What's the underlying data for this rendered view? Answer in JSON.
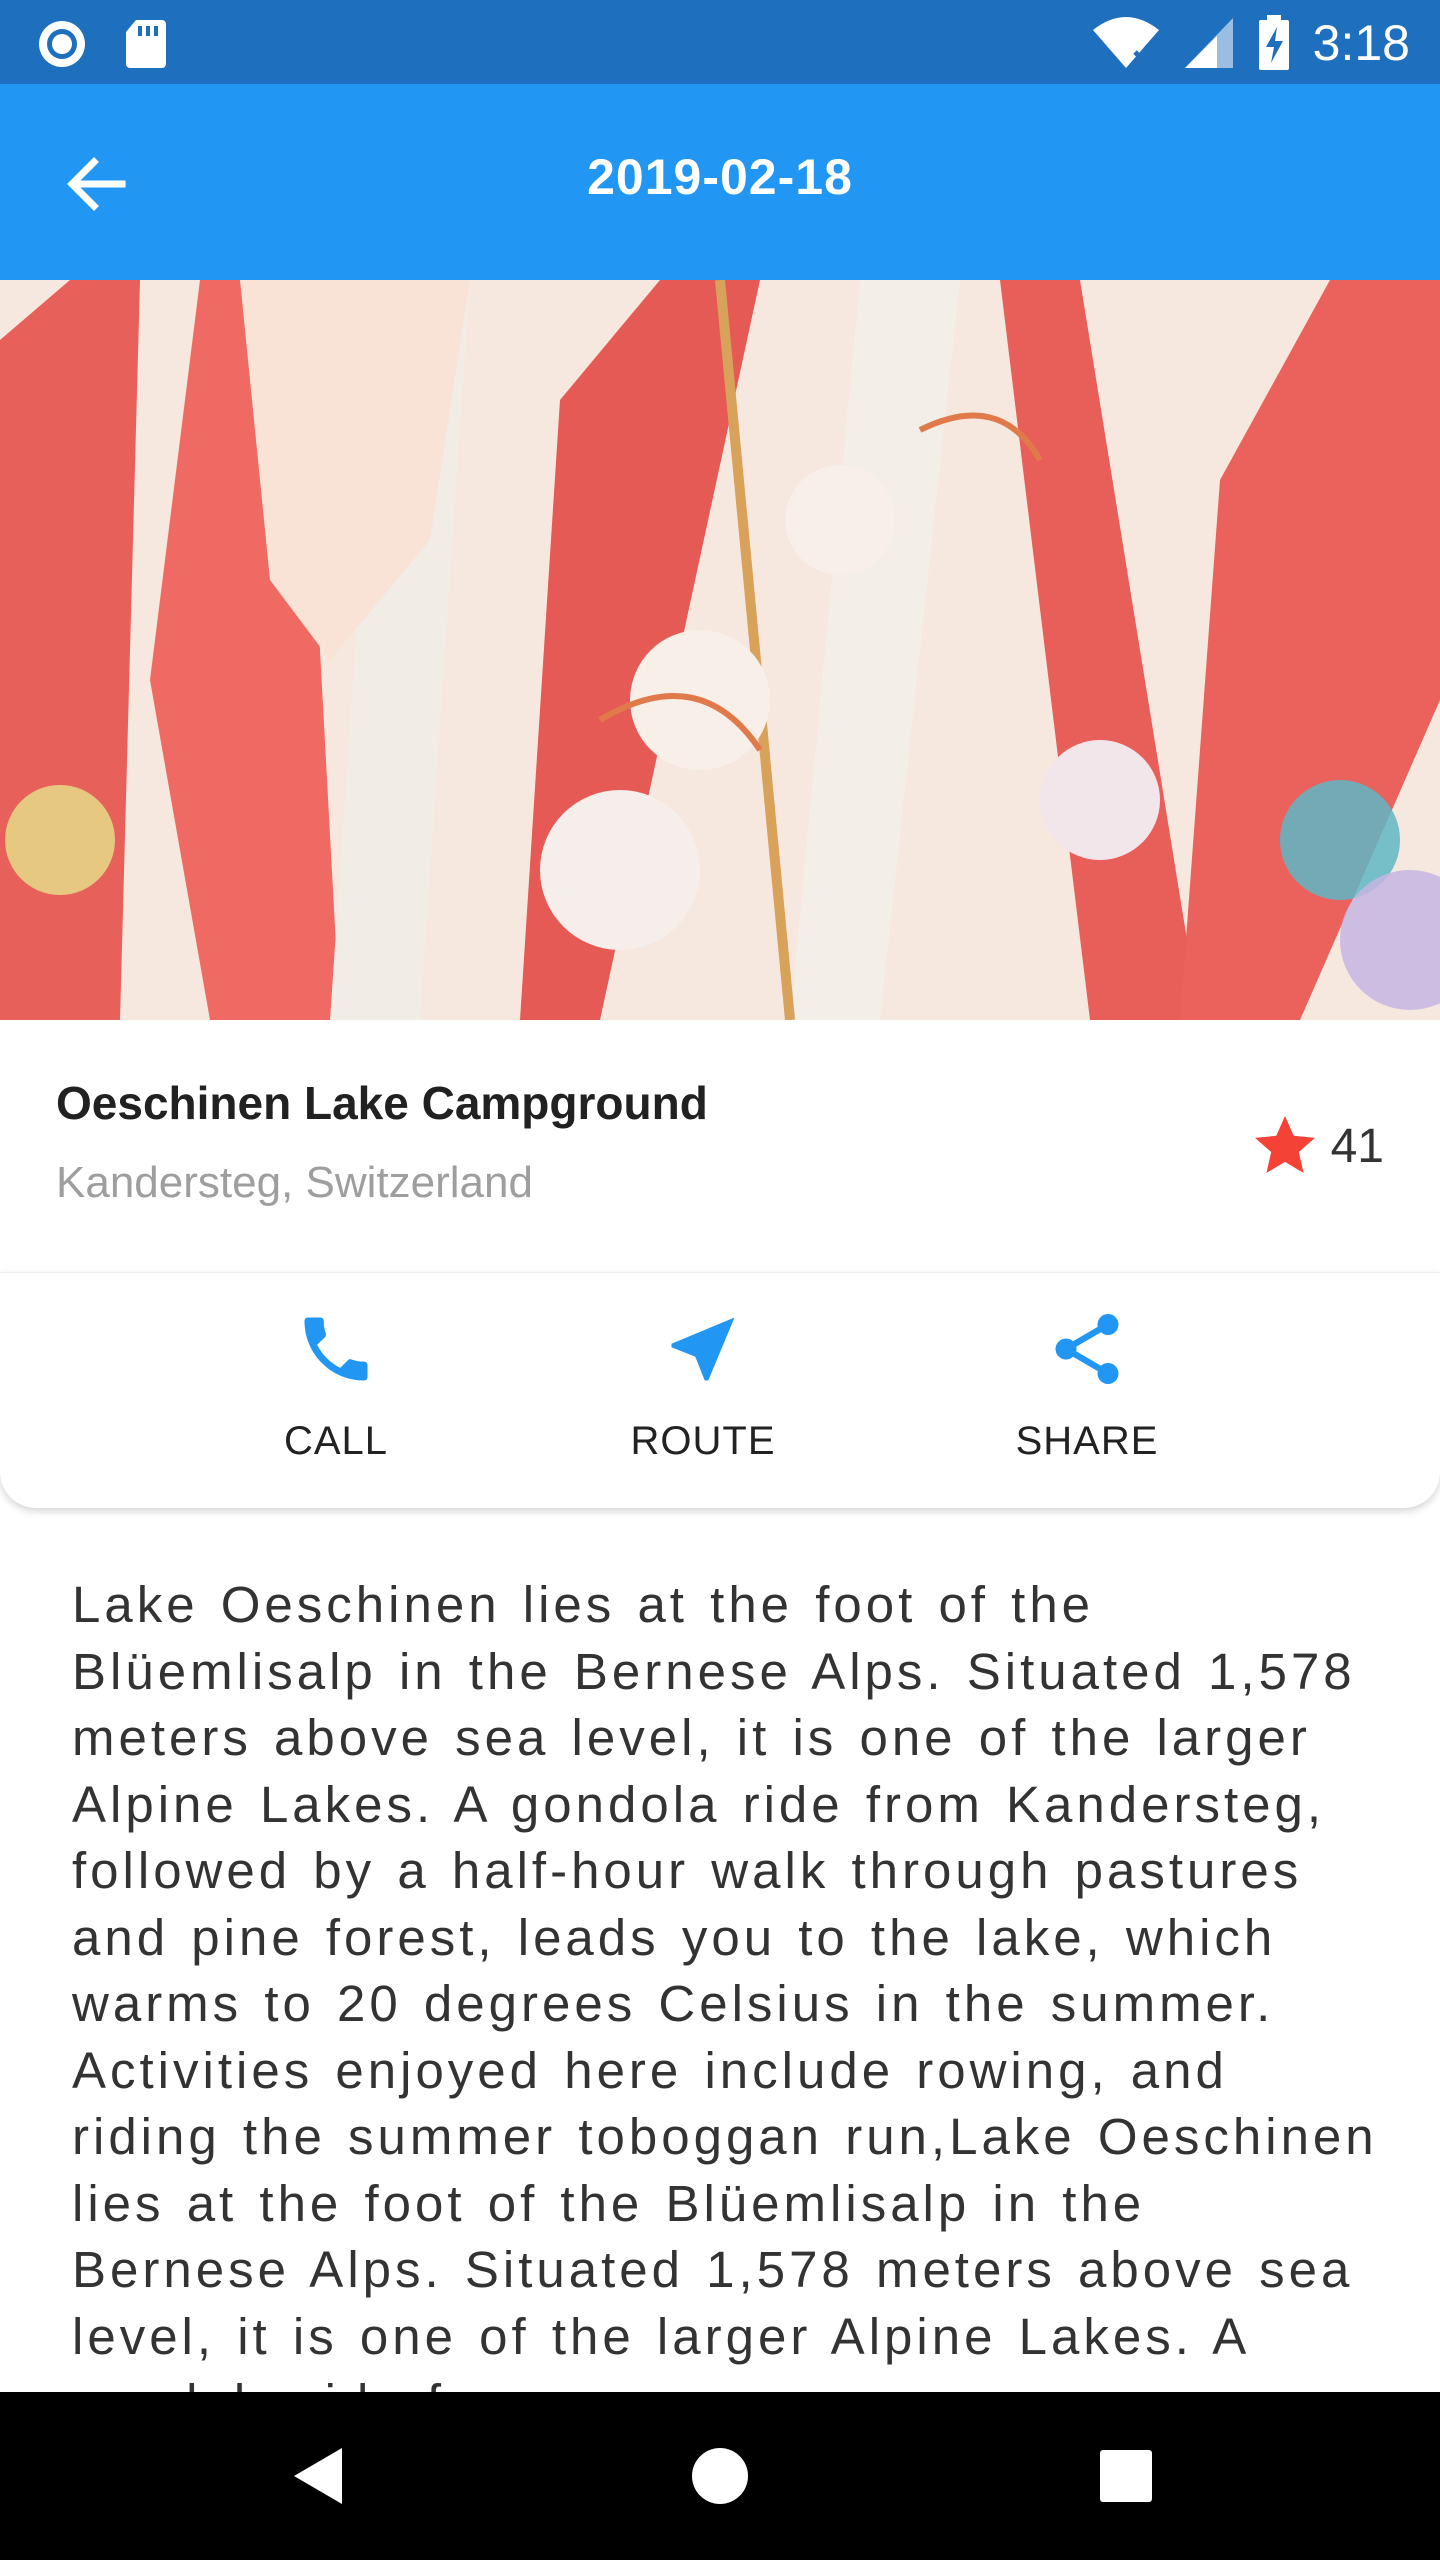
{
  "status_bar": {
    "time": "3:18",
    "left_icons": [
      "circle-notification-icon",
      "sd-card-icon"
    ],
    "right_icons": [
      "wifi-icon",
      "cell-signal-icon",
      "battery-charging-icon"
    ]
  },
  "app_bar": {
    "title": "2019-02-18",
    "back_icon": "arrow-back-icon"
  },
  "hero": {
    "image": "kimono-photo"
  },
  "place": {
    "name": "Oeschinen Lake Campground",
    "location": "Kandersteg, Switzerland",
    "rating_count": "41",
    "star_color": "#f44336"
  },
  "actions": [
    {
      "label": "CALL",
      "icon": "phone-icon"
    },
    {
      "label": "ROUTE",
      "icon": "navigation-icon"
    },
    {
      "label": "SHARE",
      "icon": "share-icon"
    }
  ],
  "description": "Lake Oeschinen lies at the foot of the Blüemlisalp in the Bernese Alps. Situated 1,578 meters above sea level, it is one of the larger Alpine Lakes. A gondola ride from Kandersteg, followed by a half-hour walk through pastures and pine forest, leads you to the lake, which warms to 20 degrees Celsius in the summer. Activities enjoyed here include rowing, and riding the summer toboggan run,Lake Oeschinen lies at the foot of the Blüemlisalp in the Bernese Alps. Situated 1,578 meters above sea level, it is one of the larger Alpine Lakes. A gondola ride from",
  "colors": {
    "status_bar": "#1f6fbf",
    "app_bar": "#2196f3",
    "accent": "#2196f3",
    "star": "#f44336"
  },
  "nav_bar": {
    "icons": [
      "back-triangle-icon",
      "home-circle-icon",
      "recents-square-icon"
    ]
  }
}
